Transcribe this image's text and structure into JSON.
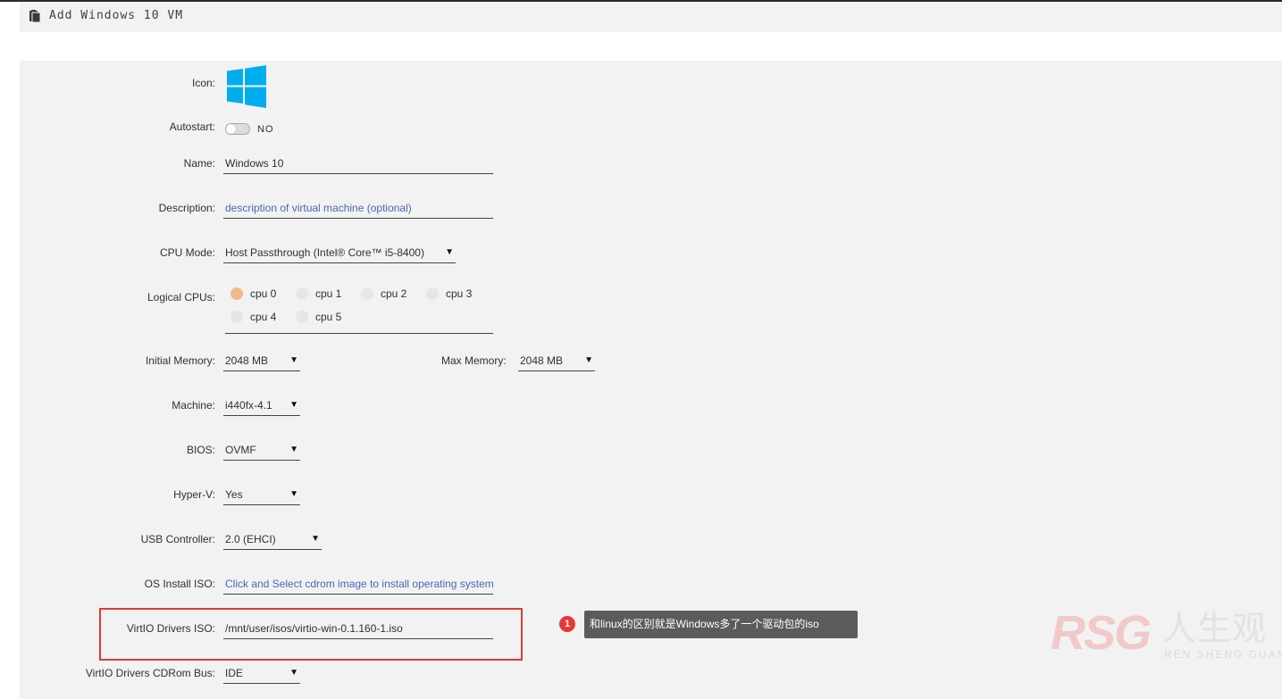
{
  "window": {
    "title": "Add Windows 10 VM"
  },
  "icon_row": {
    "label": "Icon:"
  },
  "autostart": {
    "label": "Autostart:",
    "value": "NO",
    "enabled": false
  },
  "name": {
    "label": "Name:",
    "value": "Windows 10"
  },
  "description": {
    "label": "Description:",
    "placeholder": "description of virtual machine (optional)"
  },
  "cpu_mode": {
    "label": "CPU Mode:",
    "value": "Host Passthrough (Intel® Core™ i5-8400)"
  },
  "logical_cpus": {
    "label": "Logical CPUs:",
    "items": [
      {
        "name": "cpu 0",
        "selected": true
      },
      {
        "name": "cpu 1",
        "selected": false
      },
      {
        "name": "cpu 2",
        "selected": false
      },
      {
        "name": "cpu 3",
        "selected": false
      },
      {
        "name": "cpu 4",
        "selected": false
      },
      {
        "name": "cpu 5",
        "selected": false
      }
    ]
  },
  "initial_memory": {
    "label": "Initial Memory:",
    "value": "2048 MB"
  },
  "max_memory": {
    "label": "Max Memory:",
    "value": "2048 MB"
  },
  "machine": {
    "label": "Machine:",
    "value": "i440fx-4.1"
  },
  "bios": {
    "label": "BIOS:",
    "value": "OVMF"
  },
  "hyper_v": {
    "label": "Hyper-V:",
    "value": "Yes"
  },
  "usb_controller": {
    "label": "USB Controller:",
    "value": "2.0 (EHCI)"
  },
  "os_install_iso": {
    "label": "OS Install ISO:",
    "placeholder": "Click and Select cdrom image to install operating system"
  },
  "virtio_drivers_iso": {
    "label": "VirtIO Drivers ISO:",
    "value": "/mnt/user/isos/virtio-win-0.1.160-1.iso"
  },
  "virtio_cdrom_bus": {
    "label": "VirtIO Drivers CDRom Bus:",
    "value": "IDE"
  },
  "annotation": {
    "number": "1",
    "text": "和linux的区别就是Windows多了一个驱动包的iso"
  },
  "watermark": {
    "brand": "RSG",
    "chinese": "人生观",
    "sub": "REN SHENG GUAN"
  },
  "colors": {
    "accent_blue": "#4a67b5",
    "windows_blue": "#00adef",
    "highlight_red": "#e53935",
    "cpu_selected": "#f4b98a"
  }
}
